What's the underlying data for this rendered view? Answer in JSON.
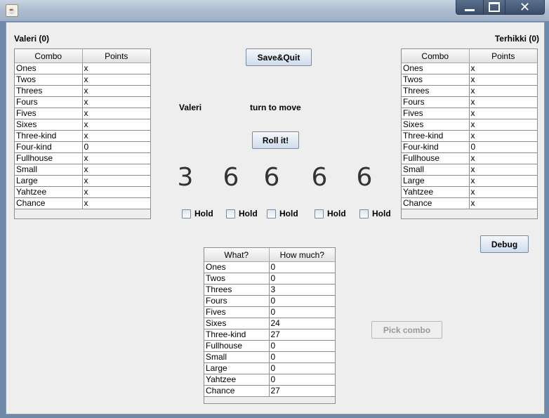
{
  "window": {
    "app_icon": "java-icon"
  },
  "left_player": {
    "name_label": "Valeri (0)",
    "headers": [
      "Combo",
      "Points"
    ],
    "rows": [
      [
        "Ones",
        "x"
      ],
      [
        "Twos",
        "x"
      ],
      [
        "Threes",
        "x"
      ],
      [
        "Fours",
        "x"
      ],
      [
        "Fives",
        "x"
      ],
      [
        "Sixes",
        "x"
      ],
      [
        "Three-kind",
        "x"
      ],
      [
        "Four-kind",
        "0"
      ],
      [
        "Fullhouse",
        "x"
      ],
      [
        "Small",
        "x"
      ],
      [
        "Large",
        "x"
      ],
      [
        "Yahtzee",
        "x"
      ],
      [
        "Chance",
        "x"
      ]
    ]
  },
  "right_player": {
    "name_label": "Terhikki (0)",
    "headers": [
      "Combo",
      "Points"
    ],
    "rows": [
      [
        "Ones",
        "x"
      ],
      [
        "Twos",
        "x"
      ],
      [
        "Threes",
        "x"
      ],
      [
        "Fours",
        "x"
      ],
      [
        "Fives",
        "x"
      ],
      [
        "Sixes",
        "x"
      ],
      [
        "Three-kind",
        "x"
      ],
      [
        "Four-kind",
        "0"
      ],
      [
        "Fullhouse",
        "x"
      ],
      [
        "Small",
        "x"
      ],
      [
        "Large",
        "x"
      ],
      [
        "Yahtzee",
        "x"
      ],
      [
        "Chance",
        "x"
      ]
    ]
  },
  "controls": {
    "save_quit": "Save&Quit",
    "current_player": "Valeri",
    "turn_text": "turn to move",
    "roll": "Roll it!",
    "debug": "Debug",
    "pick_combo": "Pick combo"
  },
  "dice": [
    "3",
    "6",
    "6",
    "6",
    "6"
  ],
  "hold_label": "Hold",
  "options": {
    "headers": [
      "What?",
      "How much?"
    ],
    "rows": [
      [
        "Ones",
        "0"
      ],
      [
        "Twos",
        "0"
      ],
      [
        "Threes",
        "3"
      ],
      [
        "Fours",
        "0"
      ],
      [
        "Fives",
        "0"
      ],
      [
        "Sixes",
        "24"
      ],
      [
        "Three-kind",
        "27"
      ],
      [
        "Fullhouse",
        "0"
      ],
      [
        "Small",
        "0"
      ],
      [
        "Large",
        "0"
      ],
      [
        "Yahtzee",
        "0"
      ],
      [
        "Chance",
        "27"
      ]
    ]
  }
}
